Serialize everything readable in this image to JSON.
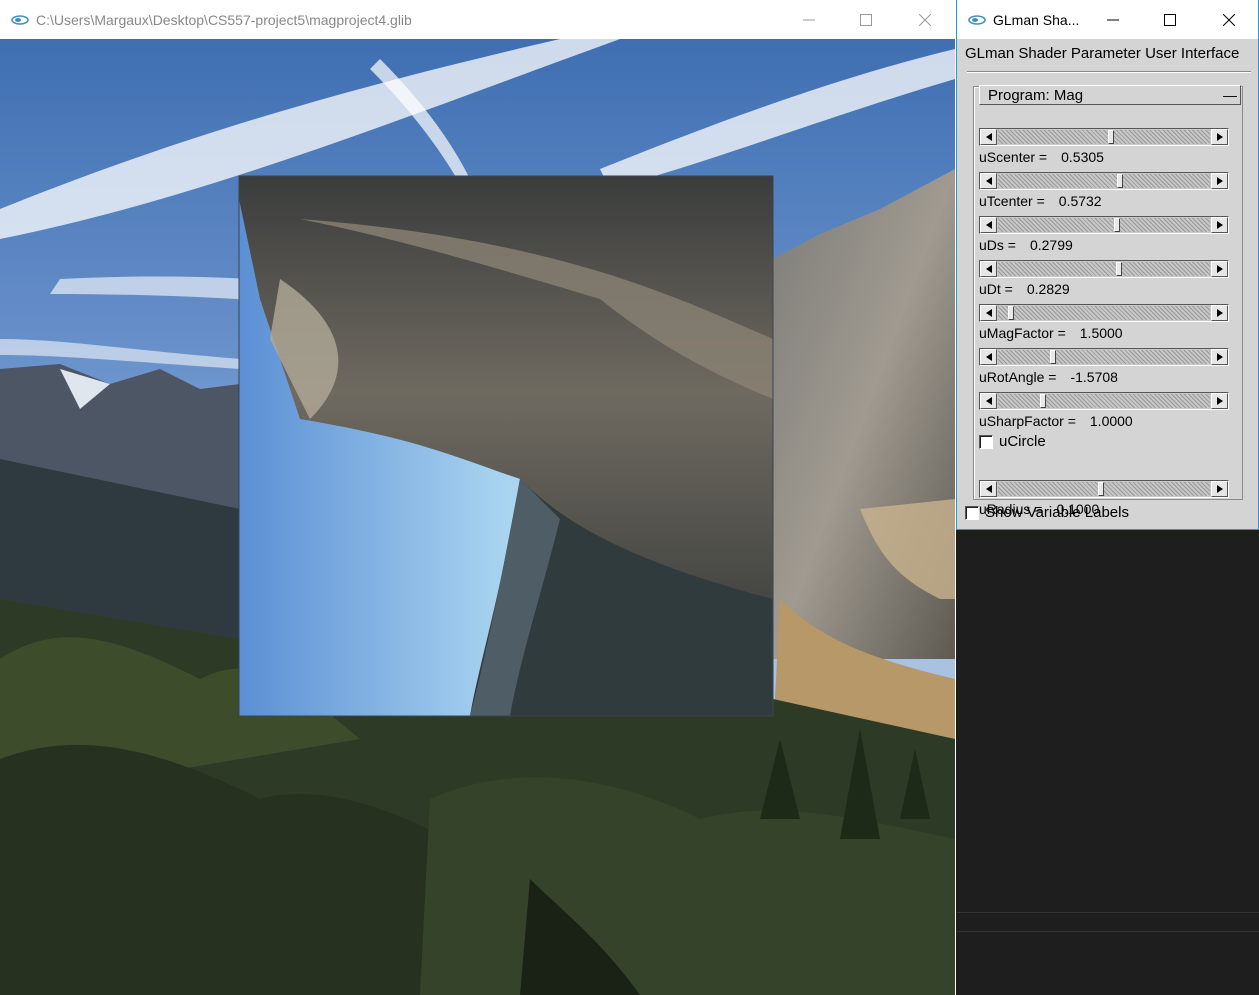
{
  "main_window": {
    "title": "C:\\Users\\Margaux\\Desktop\\CS557-project5\\magproject4.glib"
  },
  "glman_window": {
    "title": "GLman Sha...",
    "header": "GLman Shader Parameter User Interface",
    "program_label": "Program: Mag",
    "collapse_symbol": "—",
    "params": [
      {
        "label": "uScenter =",
        "value": "0.5305",
        "fraction": 0.5305
      },
      {
        "label": "uTcenter =",
        "value": "0.5732",
        "fraction": 0.5732
      },
      {
        "label": "uDs =",
        "value": "0.2799",
        "fraction": 0.5598
      },
      {
        "label": "uDt =",
        "value": "0.2829",
        "fraction": 0.5658
      },
      {
        "label": "uMagFactor =",
        "value": "1.5000",
        "fraction": 0.05
      },
      {
        "label": "uRotAngle =",
        "value": "-1.5708",
        "fraction": 0.25
      },
      {
        "label": "uSharpFactor =",
        "value": "1.0000",
        "fraction": 0.2
      },
      {
        "label": "uRadius =",
        "value": "0.1000",
        "fraction": 0.48
      }
    ],
    "checkbox_circle": {
      "label": "uCircle",
      "checked": false
    },
    "checkbox_show_labels": {
      "label": "Show Variable Labels",
      "checked": false
    }
  }
}
